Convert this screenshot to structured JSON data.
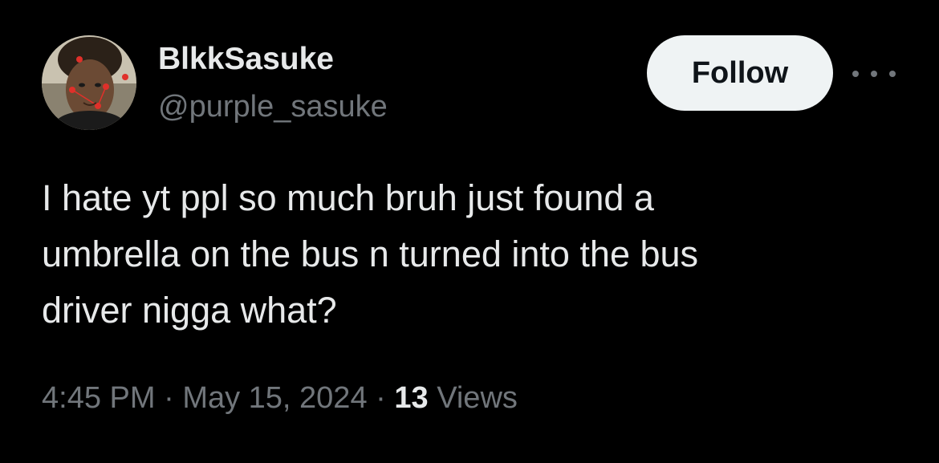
{
  "user": {
    "display_name": "BlkkSasuke",
    "handle": "@purple_sasuke"
  },
  "actions": {
    "follow_label": "Follow",
    "more_icon": "more-horizontal-icon"
  },
  "tweet": {
    "lines": [
      "I hate yt ppl so much bruh just found a",
      "umbrella on the bus n turned into the bus",
      "driver nigga what?"
    ]
  },
  "meta": {
    "time": "4:45 PM",
    "separator": "·",
    "date": "May 15, 2024",
    "views_count": "13",
    "views_label": "Views"
  },
  "colors": {
    "background": "#000000",
    "primary_text": "#e7e9ea",
    "secondary_text": "#71767b",
    "follow_button_bg": "#eff3f4",
    "follow_button_text": "#0f1419"
  }
}
